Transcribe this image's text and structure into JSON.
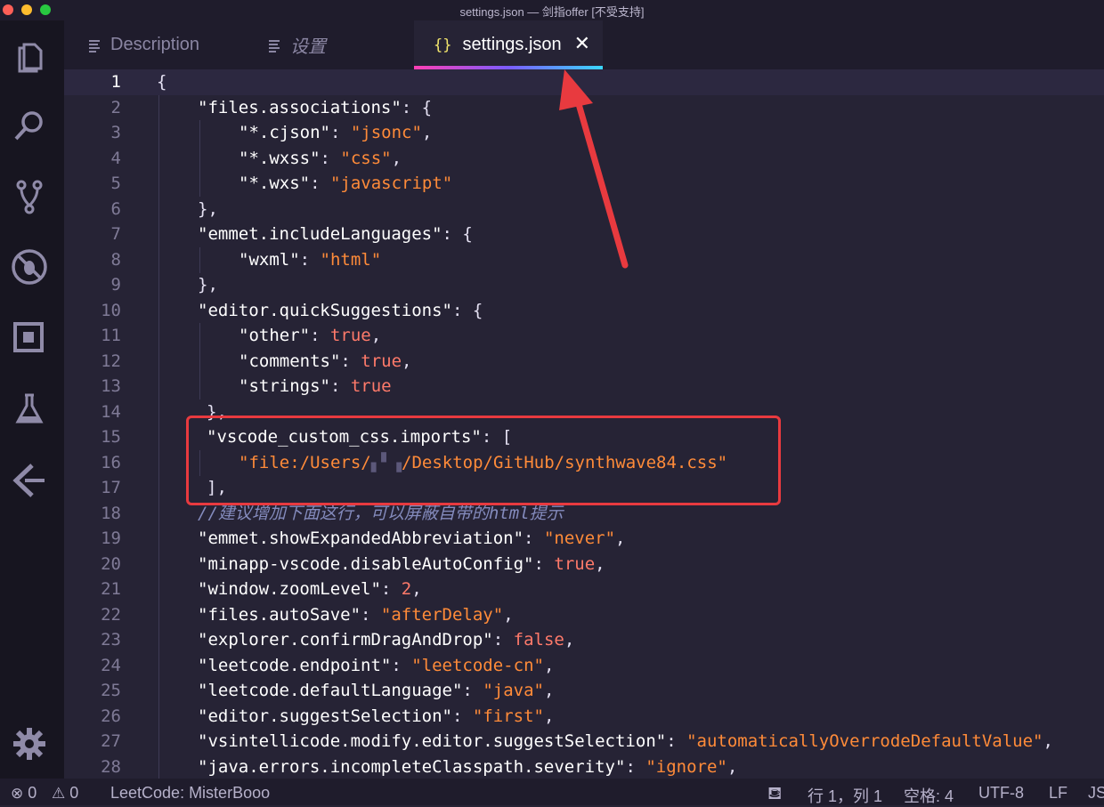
{
  "window": {
    "title": "settings.json — 剑指offer [不受支持]"
  },
  "activity_bar": [
    {
      "name": "explorer-icon"
    },
    {
      "name": "search-icon"
    },
    {
      "name": "source-control-icon"
    },
    {
      "name": "debug-icon"
    },
    {
      "name": "extensions-icon"
    },
    {
      "name": "test-flask-icon"
    },
    {
      "name": "leetcode-icon"
    },
    {
      "name": "gear-icon"
    }
  ],
  "tabs": [
    {
      "label": "Description"
    },
    {
      "label": "设置"
    },
    {
      "label": "settings.json",
      "icon_text": "{}",
      "close": "✕"
    }
  ],
  "editor": {
    "lines": [
      {
        "n": "1"
      },
      {
        "n": "2"
      },
      {
        "n": "3"
      },
      {
        "n": "4"
      },
      {
        "n": "5"
      },
      {
        "n": "6"
      },
      {
        "n": "7"
      },
      {
        "n": "8"
      },
      {
        "n": "9"
      },
      {
        "n": "10"
      },
      {
        "n": "11"
      },
      {
        "n": "12"
      },
      {
        "n": "13"
      },
      {
        "n": "14"
      },
      {
        "n": "15"
      },
      {
        "n": "16"
      },
      {
        "n": "17"
      },
      {
        "n": "18"
      },
      {
        "n": "19"
      },
      {
        "n": "20"
      },
      {
        "n": "21"
      },
      {
        "n": "22"
      },
      {
        "n": "23"
      },
      {
        "n": "24"
      },
      {
        "n": "25"
      },
      {
        "n": "26"
      },
      {
        "n": "27"
      },
      {
        "n": "28"
      }
    ],
    "code": {
      "l1": "{",
      "l2k": "\"files.associations\"",
      "l2p": ": {",
      "l3k": "\"*.cjson\"",
      "l3s": "\"jsonc\"",
      "l4k": "\"*.wxss\"",
      "l4s": "\"css\"",
      "l5k": "\"*.wxs\"",
      "l5s": "\"javascript\"",
      "l6": "},",
      "l7k": "\"emmet.includeLanguages\"",
      "l7p": ": {",
      "l8k": "\"wxml\"",
      "l8s": "\"html\"",
      "l9": "},",
      "l10k": "\"editor.quickSuggestions\"",
      "l10p": ": {",
      "l11k": "\"other\"",
      "l11v": "true",
      "l12k": "\"comments\"",
      "l12v": "true",
      "l13k": "\"strings\"",
      "l13v": "true",
      "l14": "},",
      "l15k": "\"vscode_custom_css.imports\"",
      "l15p": ": [",
      "l16s1": "\"file:/Users/",
      "l16s2": "/Desktop/GitHub/synthwave84.css\"",
      "l17": "],",
      "l18c": "//建议增加下面这行，可以屏蔽自带的html提示",
      "l19k": "\"emmet.showExpandedAbbreviation\"",
      "l19s": "\"never\"",
      "l20k": "\"minapp-vscode.disableAutoConfig\"",
      "l20v": "true",
      "l21k": "\"window.zoomLevel\"",
      "l21v": "2",
      "l22k": "\"files.autoSave\"",
      "l22s": "\"afterDelay\"",
      "l23k": "\"explorer.confirmDragAndDrop\"",
      "l23v": "false",
      "l24k": "\"leetcode.endpoint\"",
      "l24s": "\"leetcode-cn\"",
      "l25k": "\"leetcode.defaultLanguage\"",
      "l25s": "\"java\"",
      "l26k": "\"editor.suggestSelection\"",
      "l26s": "\"first\"",
      "l27k": "\"vsintellicode.modify.editor.suggestSelection\"",
      "l27s": "\"automaticallyOverrodeDefaultValue\"",
      "l28k": "\"java.errors.incompleteClasspath.severity\"",
      "l28s": "\"ignore\""
    }
  },
  "status_bar": {
    "errors": "0",
    "warnings": "0",
    "leetcode": "LeetCode: MisterBooo",
    "position": "行 1，列 1",
    "spaces": "空格: 4",
    "encoding": "UTF-8",
    "eol": "LF",
    "language": "JS"
  },
  "colors": {
    "accent_gradient_start": "#ff3fb4",
    "accent_gradient_end": "#3ad7ff",
    "annotation_red": "#e83a3f",
    "string_orange": "#ff8b39"
  }
}
